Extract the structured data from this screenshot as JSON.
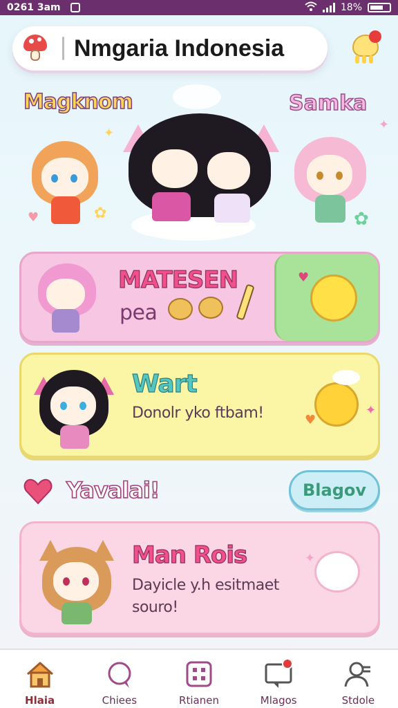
{
  "status_bar": {
    "time": "0261 3am",
    "battery": "18%"
  },
  "header": {
    "title": "Nmgaria Indonesia"
  },
  "hero": {
    "left_label": "Magknom",
    "right_label": "Samka"
  },
  "cards": [
    {
      "title": "MATESEN",
      "subtitle": "pea"
    },
    {
      "title": "Wart",
      "subtitle": "Donolr yko ftbam!"
    },
    {
      "title": "Man Rois",
      "subtitle": "Dayicle y.h esitmaet souro!"
    }
  ],
  "section": {
    "title": "Yavalai!",
    "button_label": "Blagov"
  },
  "bottom_nav": {
    "items": [
      {
        "label": "Hlaia",
        "icon": "home-icon"
      },
      {
        "label": "Chiees",
        "icon": "chat-icon"
      },
      {
        "label": "Rtianen",
        "icon": "grid-icon"
      },
      {
        "label": "Mlagos",
        "icon": "message-icon"
      },
      {
        "label": "Stdole",
        "icon": "profile-icon"
      }
    ]
  },
  "colors": {
    "status_bar": "#6b2f6e",
    "card_pink": "#f7c6e2",
    "card_green": "#a9e39a",
    "card_yellow": "#fbf5a6",
    "card_rose": "#fbd6e4",
    "accent": "#a0437a"
  }
}
